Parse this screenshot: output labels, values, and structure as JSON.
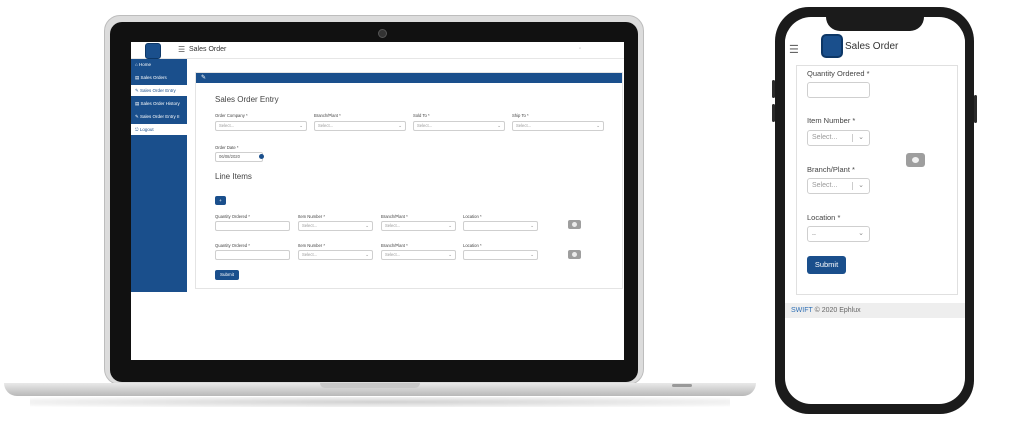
{
  "laptop": {
    "header_title": "Sales Order",
    "sidebar": [
      {
        "label": "Home",
        "icon": "home-icon",
        "active": false
      },
      {
        "label": "Sales Orders",
        "icon": "list-icon",
        "active": false
      },
      {
        "label": "Sales Order Entry",
        "icon": "pencil-icon",
        "active": true
      },
      {
        "label": "Sales Order History",
        "icon": "history-icon",
        "active": false
      },
      {
        "label": "Sales Order Entry II",
        "icon": "pencil-icon",
        "active": false
      },
      {
        "label": "Logout",
        "icon": "logout-icon",
        "active": true
      }
    ],
    "form_title": "Sales Order Entry",
    "fields": [
      {
        "label": "Order Company *",
        "placeholder": "Select..."
      },
      {
        "label": "Branch/Plant *",
        "placeholder": "Select..."
      },
      {
        "label": "Sold To *",
        "placeholder": "Select..."
      },
      {
        "label": "Ship To *",
        "placeholder": "Select..."
      }
    ],
    "order_date_label": "Order Date *",
    "order_date_value": "06/08/2020",
    "line_items_title": "Line Items",
    "line_rows": [
      {
        "qty_label": "Quantity Ordered *",
        "item_label": "Item Number *",
        "item_placeholder": "Select...",
        "branch_label": "Branch/Plant *",
        "branch_placeholder": "Select...",
        "location_label": "Location *"
      },
      {
        "qty_label": "Quantity Ordered *",
        "item_label": "Item Number *",
        "item_placeholder": "Select...",
        "branch_label": "Branch/Plant *",
        "branch_placeholder": "Select...",
        "location_label": "Location *"
      }
    ],
    "submit_label": "Submit"
  },
  "phone": {
    "header_title": "Sales Order",
    "qty_label": "Quantity Ordered *",
    "item_label": "Item Number *",
    "item_placeholder": "Select...",
    "branch_label": "Branch/Plant *",
    "branch_placeholder": "Select...",
    "location_label": "Location *",
    "location_value": "..",
    "submit_label": "Submit",
    "footer_brand": "SWIFT",
    "footer_text": " © 2020 Ephlux"
  },
  "colors": {
    "brand": "#1a4f8c",
    "button_gray": "#9e9e9e"
  }
}
